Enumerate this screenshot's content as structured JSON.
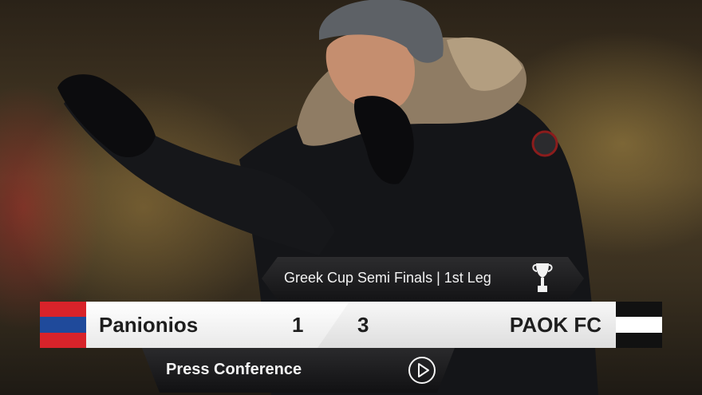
{
  "banner": {
    "title": "Greek Cup Semi Finals | 1st Leg",
    "icon": "trophy-icon"
  },
  "match": {
    "home_team": "Panionios",
    "home_score": "1",
    "away_score": "3",
    "away_team": "PAOK FC",
    "home_colors": [
      "#d8232a",
      "#1f4a9b"
    ],
    "away_colors": [
      "#111111",
      "#ffffff"
    ]
  },
  "press": {
    "label": "Press Conference",
    "icon": "play-icon"
  }
}
